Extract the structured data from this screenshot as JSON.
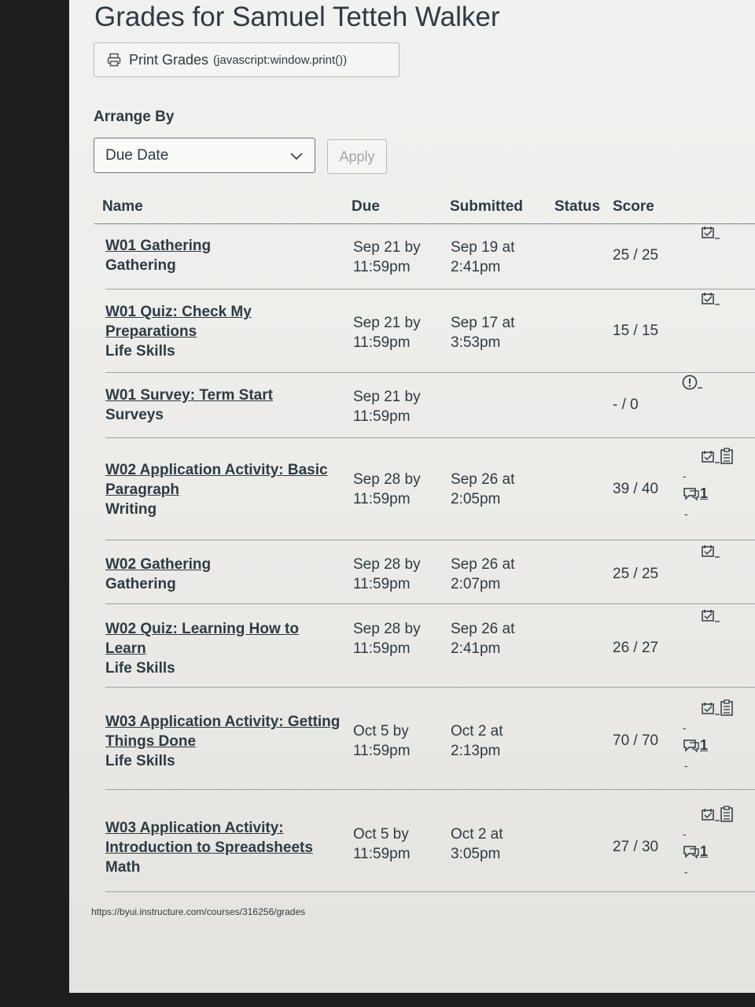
{
  "page": {
    "title": "Grades for Samuel Tetteh Walker",
    "print_button": {
      "label": "Print Grades",
      "url": "(javascript:window.print())",
      "icon": "printer-icon"
    },
    "arrange_by": {
      "label": "Arrange By",
      "selected": "Due Date",
      "apply_label": "Apply"
    },
    "columns": {
      "name": "Name",
      "due": "Due",
      "submitted": "Submitted",
      "status": "Status",
      "score": "Score"
    },
    "rows": [
      {
        "title": "W01 Gathering",
        "category": "Gathering",
        "due": [
          "Sep 21 by",
          "11:59pm"
        ],
        "submitted": [
          "Sep 19 at",
          "2:41pm"
        ],
        "score": "25 / 25",
        "icons": [
          "submission-icon"
        ]
      },
      {
        "title": "W01 Quiz: Check My Preparations",
        "category": "Life Skills",
        "due": [
          "Sep 21 by",
          "11:59pm"
        ],
        "submitted": [
          "Sep 17 at",
          "3:53pm"
        ],
        "score": "15 / 15",
        "icons": [
          "submission-icon"
        ]
      },
      {
        "title": "W01 Survey: Term Start",
        "category": "Surveys",
        "due": [
          "Sep 21 by",
          "11:59pm"
        ],
        "submitted": [
          "",
          ""
        ],
        "score": "- / 0",
        "icons": [
          "alert-icon"
        ]
      },
      {
        "title": "W02 Application Activity: Basic Paragraph",
        "category": "Writing",
        "due": [
          "Sep 28 by",
          "11:59pm"
        ],
        "submitted": [
          "Sep 26 at",
          "2:05pm"
        ],
        "score": "39 / 40",
        "icons": [
          "submission-icon",
          "rubric-icon",
          "comment-icon"
        ],
        "comments": "1"
      },
      {
        "title": "W02 Gathering",
        "category": "Gathering",
        "due": [
          "Sep 28 by",
          "11:59pm"
        ],
        "submitted": [
          "Sep 26 at",
          "2:07pm"
        ],
        "score": "25 / 25",
        "icons": [
          "submission-icon"
        ]
      },
      {
        "title": "W02 Quiz: Learning How to Learn",
        "category": "Life Skills",
        "due": [
          "Sep 28 by",
          "11:59pm"
        ],
        "submitted": [
          "Sep 26 at",
          "2:41pm"
        ],
        "score": "26 / 27",
        "icons": [
          "submission-icon"
        ]
      },
      {
        "title": "W03 Application Activity: Getting Things Done",
        "category": "Life Skills",
        "due": [
          "Oct 5 by",
          "11:59pm"
        ],
        "submitted": [
          "Oct 2 at",
          "2:13pm"
        ],
        "score": "70 / 70",
        "icons": [
          "submission-icon",
          "rubric-icon",
          "comment-icon"
        ],
        "comments": "1"
      },
      {
        "title": "W03 Application Activity: Introduction to Spreadsheets",
        "category": "Math",
        "due": [
          "Oct 5 by",
          "11:59pm"
        ],
        "submitted": [
          "Oct 2 at",
          "3:05pm"
        ],
        "score": "27 / 30",
        "icons": [
          "submission-icon",
          "rubric-icon",
          "comment-icon"
        ],
        "comments": "1"
      }
    ],
    "footer_url": "https://byui.instructure.com/courses/316256/grades"
  }
}
